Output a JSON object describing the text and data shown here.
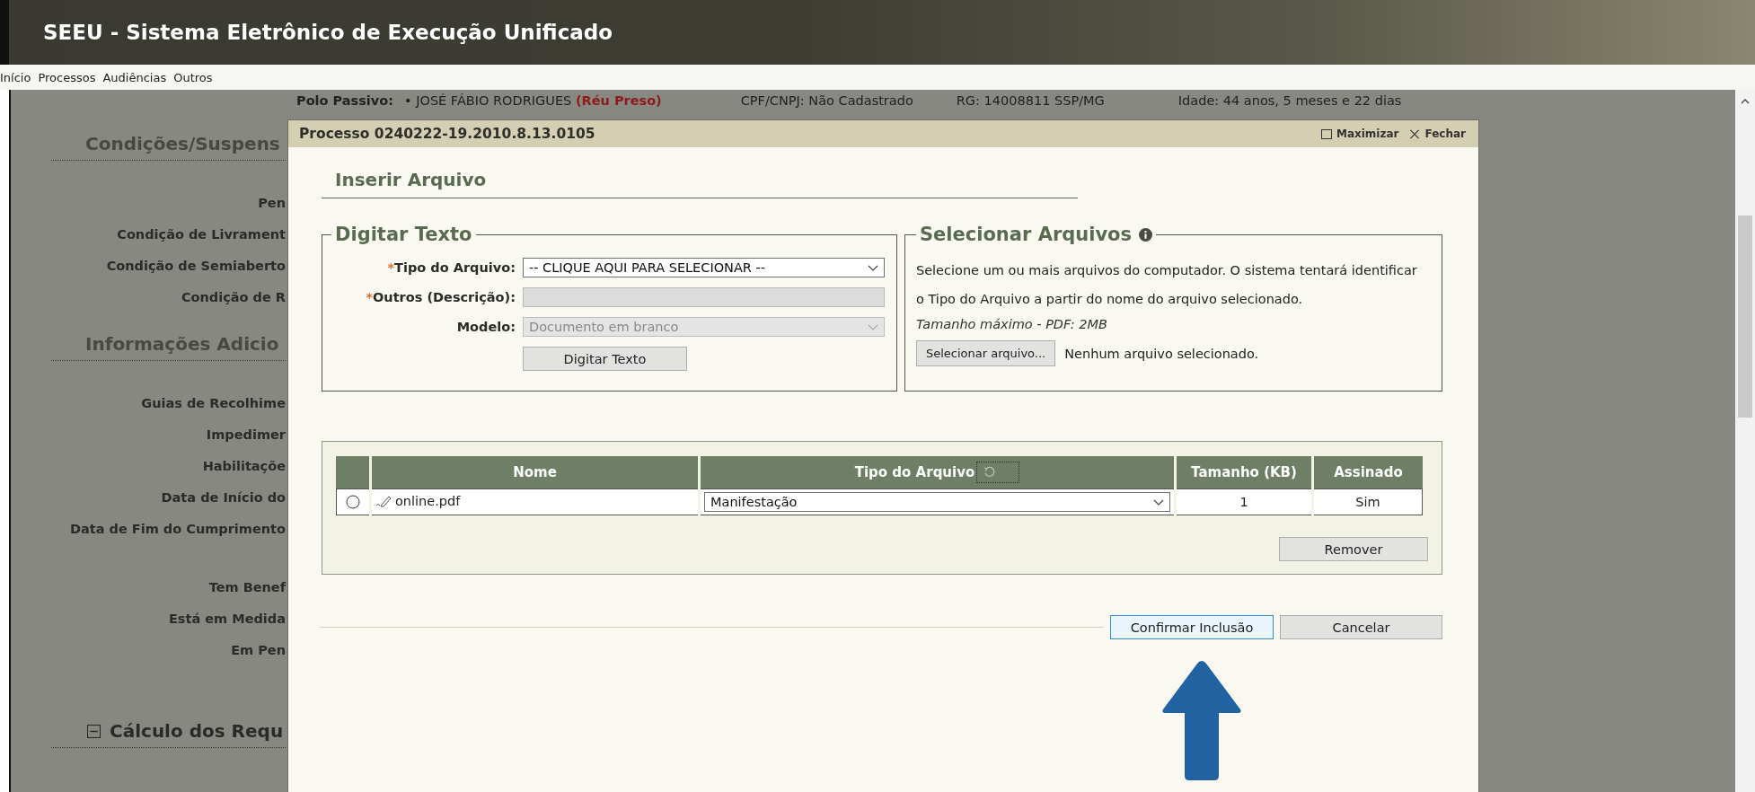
{
  "header": {
    "title": "SEEU - Sistema Eletrônico de Execução Unificado"
  },
  "menu": [
    {
      "label": "Início"
    },
    {
      "label": "Processos"
    },
    {
      "label": "Audiências"
    },
    {
      "label": "Outros"
    }
  ],
  "party": {
    "label": "Polo Passivo:",
    "bullet": "•",
    "name": "JOSÉ FÁBIO RODRIGUES",
    "status": "(Réu Preso)",
    "cpf": "CPF/CNPJ: Não Cadastrado",
    "rg": "RG: 14008811 SSP/MG",
    "age": "Idade: 44 anos, 5 meses e 22 dias"
  },
  "background_sections": [
    {
      "title": "Condições/Suspens",
      "collapsible": false,
      "groups": [
        [
          "Pen",
          "Condição de Livrament",
          "Condição de Semiaberto",
          "Condição de R"
        ]
      ]
    },
    {
      "title": "Informações Adicio",
      "collapsible": false,
      "groups": [
        [
          "Guias de Recolhime",
          "Impedimer",
          "Habilitaçõe",
          "Data de Início do",
          "Data de Fim do Cumprimento"
        ],
        [
          "Tem Benef",
          "Está em Medida",
          "Em Pen"
        ]
      ]
    },
    {
      "title": "Cálculo dos Requ",
      "collapsible": true
    }
  ],
  "modal": {
    "title": "Processo 0240222-19.2010.8.13.0105",
    "maximize": "Maximizar",
    "close": "Fechar",
    "heading": "Inserir Arquivo",
    "type_text": {
      "legend": "Digitar Texto",
      "required_mark": "*",
      "fields": [
        {
          "label": "Tipo do Arquivo:",
          "required": true,
          "kind": "select",
          "value": "-- CLIQUE AQUI PARA SELECIONAR --",
          "disabled": false
        },
        {
          "label": "Outros (Descrição):",
          "required": true,
          "kind": "text",
          "disabled": true
        },
        {
          "label": "Modelo:",
          "required": false,
          "kind": "select",
          "value": "Documento em branco",
          "disabled": true
        }
      ],
      "button": "Digitar Texto"
    },
    "select_files": {
      "legend": "Selecionar Arquivos",
      "description": "Selecione um ou mais arquivos do computador. O sistema tentará identificar o Tipo do Arquivo a partir do nome do arquivo selecionado.",
      "max_size": "Tamanho máximo - PDF: 2MB",
      "button": "Selecionar arquivo...",
      "status": "Nenhum arquivo selecionado."
    },
    "files_table": {
      "columns": [
        "Nome",
        "Tipo do Arquivo",
        "Tamanho (KB)",
        "Assinado"
      ],
      "rows": [
        {
          "selected": false,
          "name": "online.pdf",
          "type": "Manifestação",
          "size": "1",
          "signed": "Sim"
        }
      ]
    },
    "remove_button": "Remover",
    "confirm_button": "Confirmar Inclusão",
    "cancel_button": "Cancelar"
  }
}
